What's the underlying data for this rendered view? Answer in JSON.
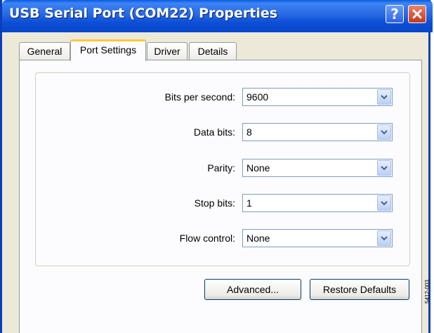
{
  "window": {
    "title": "USB Serial Port (COM22) Properties"
  },
  "titlebar": {
    "help_label": "?"
  },
  "tabs": [
    {
      "label": "General",
      "active": false
    },
    {
      "label": "Port Settings",
      "active": true
    },
    {
      "label": "Driver",
      "active": false
    },
    {
      "label": "Details",
      "active": false
    }
  ],
  "settings": {
    "bits_per_second": {
      "label": "Bits per second:",
      "value": "9600"
    },
    "data_bits": {
      "label": "Data bits:",
      "value": "8"
    },
    "parity": {
      "label": "Parity:",
      "value": "None"
    },
    "stop_bits": {
      "label": "Stop bits:",
      "value": "1"
    },
    "flow_control": {
      "label": "Flow control:",
      "value": "None"
    }
  },
  "buttons": {
    "advanced": "Advanced...",
    "restore_defaults": "Restore Defaults"
  },
  "figure_code": "5412-003",
  "colors": {
    "titlebar": "#0c4ed6",
    "active_tab_accent": "#ffc83c",
    "close": "#c4391e"
  }
}
